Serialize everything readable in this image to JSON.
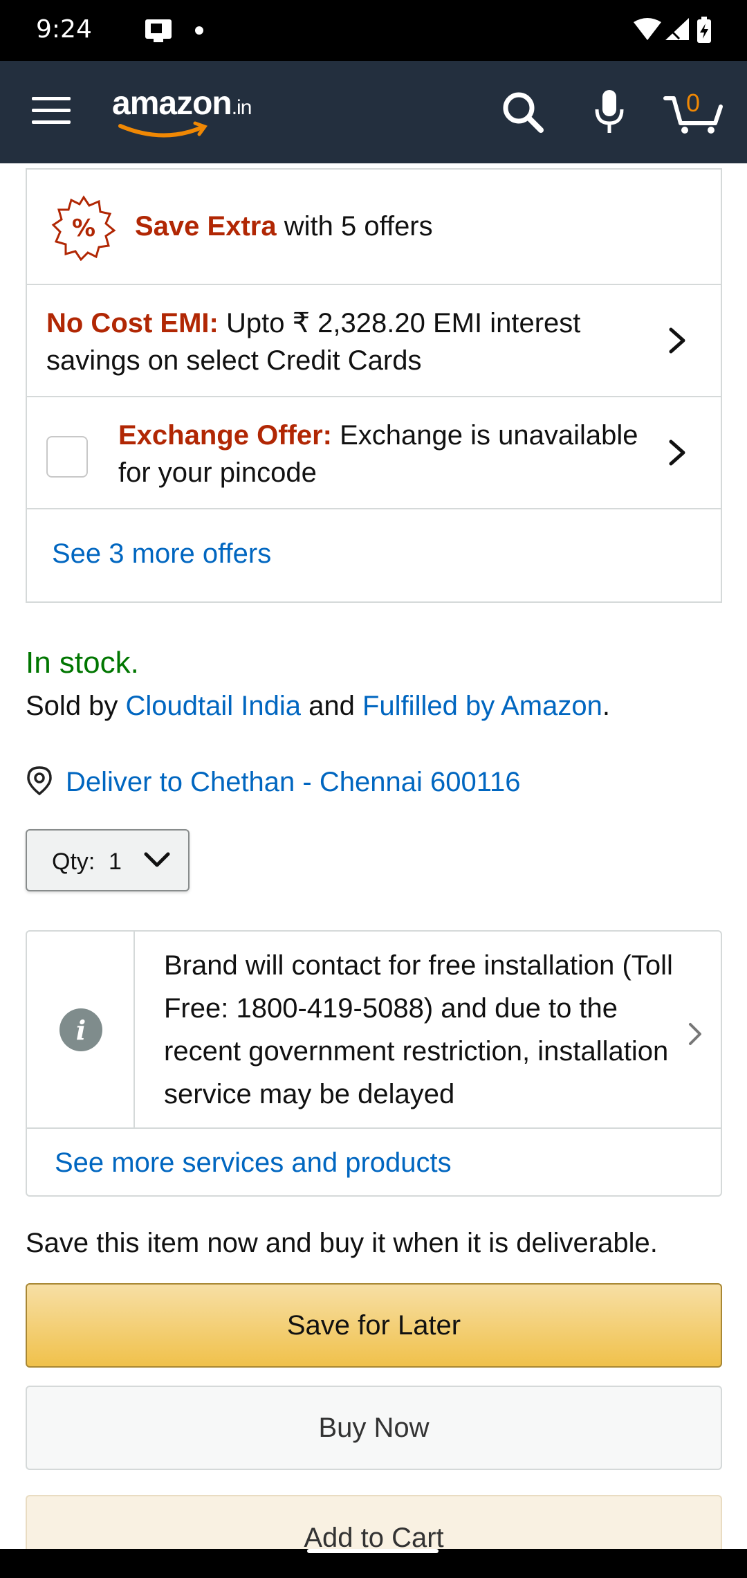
{
  "status_bar": {
    "time": "9:24"
  },
  "header": {
    "logo_text": "amazon",
    "logo_suffix": ".in",
    "cart_count": "0",
    "brand_color": "#232f3e",
    "accent_color": "#f08804"
  },
  "offers": {
    "save_extra_strong": "Save Extra",
    "save_extra_rest": " with 5 offers",
    "emi_strong": "No Cost EMI:",
    "emi_rest": " Upto ₹ 2,328.20 EMI interest savings on select Credit Cards",
    "exchange_strong": "Exchange Offer:",
    "exchange_rest": " Exchange is unavailable for your pincode",
    "see_more": "See 3 more offers"
  },
  "availability": {
    "stock": "In stock.",
    "sold_by_prefix": "Sold by ",
    "seller": "Cloudtail India",
    "sold_by_mid": " and ",
    "fulfilled": "Fulfilled by Amazon",
    "sold_by_suffix": "."
  },
  "delivery": {
    "text": "Deliver to Chethan - Chennai 600116"
  },
  "quantity": {
    "label": "Qty:",
    "value": "1"
  },
  "installation": {
    "text": "Brand will contact for free installation (Toll Free: 1800-419-5088) and due to the recent government restriction, installation service may be delayed",
    "see_more": "See more services and products"
  },
  "save_note": "Save this item now and buy it when it is deliverable.",
  "buttons": {
    "save_for_later": "Save for Later",
    "buy_now": "Buy Now",
    "add_to_cart": "Add to Cart"
  }
}
